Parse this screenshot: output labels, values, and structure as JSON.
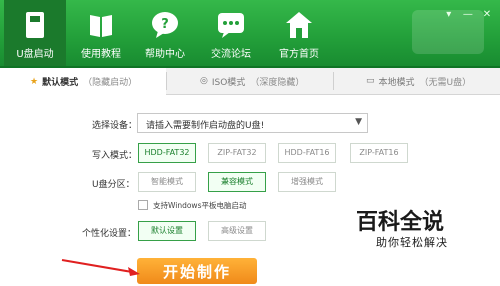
{
  "nav": {
    "items": [
      {
        "label": "U盘启动",
        "icon": "usb-drive-icon"
      },
      {
        "label": "使用教程",
        "icon": "book-icon"
      },
      {
        "label": "帮助中心",
        "icon": "help-bubble-icon"
      },
      {
        "label": "交流论坛",
        "icon": "chat-bubble-icon"
      },
      {
        "label": "官方首页",
        "icon": "home-icon"
      }
    ],
    "window_buttons": [
      "▾",
      "—",
      "✕"
    ]
  },
  "tabs": [
    {
      "label": "默认模式",
      "sub": "（隐藏启动）",
      "icon": "star-icon"
    },
    {
      "label": "ISO模式",
      "sub": "（深度隐藏）",
      "icon": "disc-icon"
    },
    {
      "label": "本地模式",
      "sub": "（无需U盘）",
      "icon": "monitor-icon"
    }
  ],
  "form": {
    "device_label": "选择设备：",
    "device_value": "请插入需要制作启动盘的U盘!",
    "write_mode_label": "写入模式：",
    "write_modes": [
      "HDD-FAT32",
      "ZIP-FAT32",
      "HDD-FAT16",
      "ZIP-FAT16"
    ],
    "selected_write_mode": "HDD-FAT32",
    "partition_label": "U盘分区：",
    "partitions": [
      "智能模式",
      "兼容模式",
      "增强模式"
    ],
    "selected_partition": "兼容模式",
    "tablet_checkbox_label": "支持Windows平板电脑启动",
    "personalize_label": "个性化设置：",
    "personalize_options": [
      "默认设置",
      "高级设置"
    ],
    "selected_personalize": "默认设置",
    "start_button": "开始制作"
  },
  "watermark": {
    "title": "百科全说",
    "subtitle": "助你轻松解决"
  },
  "colors": {
    "brand_green": "#23a03a",
    "accent_orange": "#f08a1a",
    "selected_border": "#36a048"
  }
}
